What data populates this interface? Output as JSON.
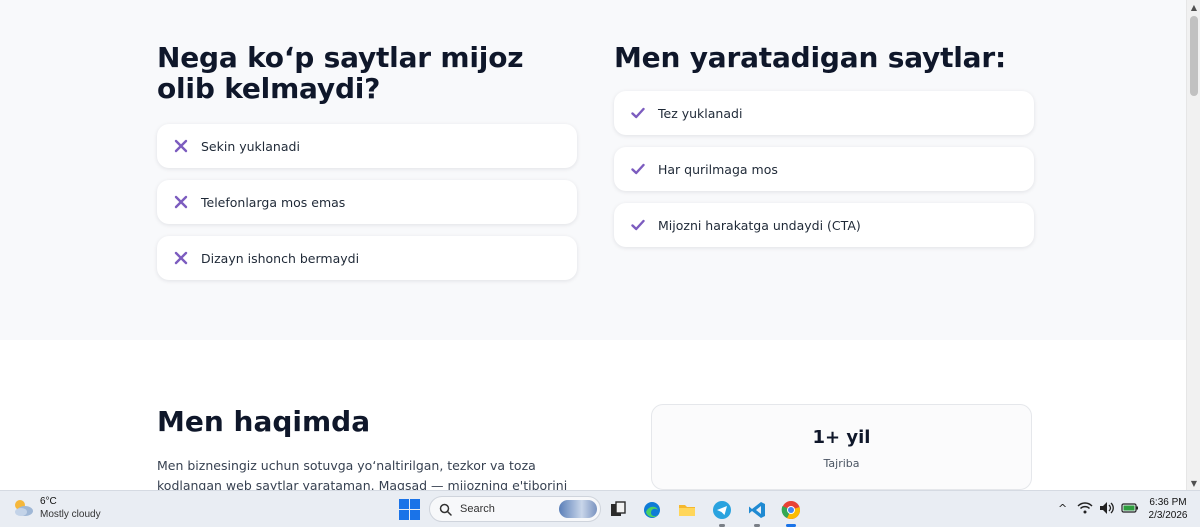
{
  "problems": {
    "heading": "Nega koʻp saytlar mijoz olib kelmaydi?",
    "items": [
      "Sekin yuklanadi",
      "Telefonlarga mos emas",
      "Dizayn ishonch bermaydi"
    ]
  },
  "solutions": {
    "heading": "Men yaratadigan saytlar:",
    "items": [
      "Tez yuklanadi",
      "Har qurilmaga mos",
      "Mijozni harakatga undaydi (CTA)"
    ]
  },
  "about": {
    "title": "Men haqimda",
    "text": "Men biznesingiz uchun sotuvga yoʻnaltirilgan, tezkor va toza kodlangan web saytlar yarataman. Maqsad — mijozning e'tiborini ushlab, aniq harakatga olib",
    "stat_value": "1+ yil",
    "stat_label": "Tajriba"
  },
  "taskbar": {
    "weather_temp": "6°C",
    "weather_desc": "Mostly cloudy",
    "search_placeholder": "Search",
    "time": "6:36 PM",
    "date": "2/3/2026"
  },
  "colors": {
    "accent": "#7c5cbf",
    "section_bg": "#f8f9fb"
  }
}
